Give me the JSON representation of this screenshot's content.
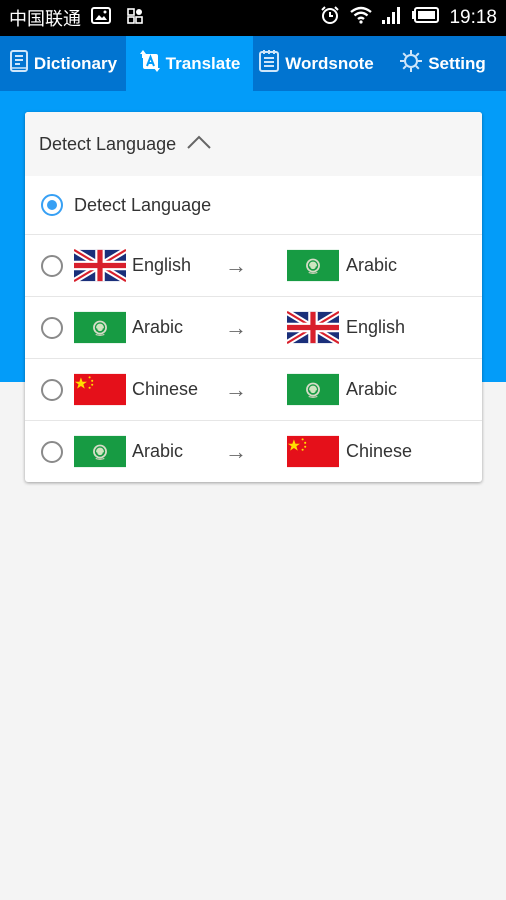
{
  "status_bar": {
    "carrier": "中国联通",
    "left_icons": [
      "image-icon",
      "apps-icon"
    ],
    "right_icons": [
      "alarm-icon",
      "wifi-icon",
      "signal-icon",
      "battery-icon"
    ],
    "time": "19:18"
  },
  "tabs": [
    {
      "label": "Dictionary",
      "icon": "book-icon",
      "active": false
    },
    {
      "label": "Translate",
      "icon": "translate-icon",
      "active": true
    },
    {
      "label": "Wordsnote",
      "icon": "notepad-icon",
      "active": false
    },
    {
      "label": "Setting",
      "icon": "gear-icon",
      "active": false
    }
  ],
  "colors": {
    "status_bar": "#000000",
    "tabbar": "#0174d0",
    "tab_active": "#039cf9",
    "header_blue": "#039cf9",
    "radio_accent": "#37a0f4",
    "background": "#f4f4f4"
  },
  "language_dropdown": {
    "selected": "Detect Language",
    "expanded": true,
    "options": [
      {
        "type": "detect",
        "label": "Detect Language",
        "checked": true
      },
      {
        "type": "pair",
        "from": "English",
        "from_flag": "uk-flag",
        "to": "Arabic",
        "to_flag": "arab-league-flag",
        "checked": false
      },
      {
        "type": "pair",
        "from": "Arabic",
        "from_flag": "arab-league-flag",
        "to": "English",
        "to_flag": "uk-flag",
        "checked": false
      },
      {
        "type": "pair",
        "from": "Chinese",
        "from_flag": "china-flag",
        "to": "Arabic",
        "to_flag": "arab-league-flag",
        "checked": false
      },
      {
        "type": "pair",
        "from": "Arabic",
        "from_flag": "arab-league-flag",
        "to": "Chinese",
        "to_flag": "china-flag",
        "checked": false
      }
    ],
    "arrow_symbol": "→"
  }
}
